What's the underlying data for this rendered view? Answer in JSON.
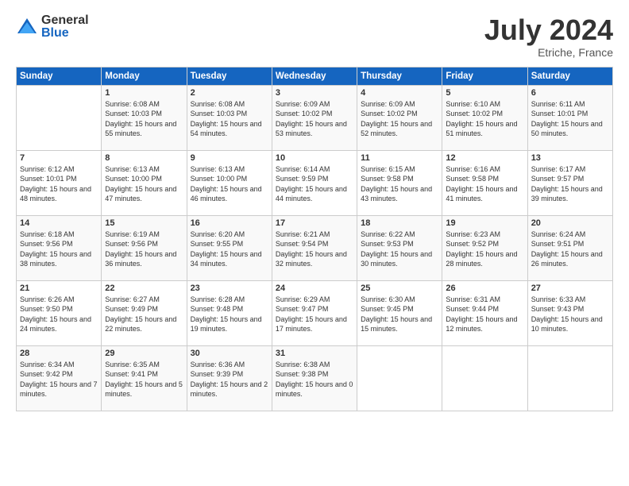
{
  "logo": {
    "general": "General",
    "blue": "Blue"
  },
  "title": "July 2024",
  "location": "Etriche, France",
  "days_of_week": [
    "Sunday",
    "Monday",
    "Tuesday",
    "Wednesday",
    "Thursday",
    "Friday",
    "Saturday"
  ],
  "weeks": [
    [
      {
        "day": "",
        "sunrise": "",
        "sunset": "",
        "daylight": ""
      },
      {
        "day": "1",
        "sunrise": "Sunrise: 6:08 AM",
        "sunset": "Sunset: 10:03 PM",
        "daylight": "Daylight: 15 hours and 55 minutes."
      },
      {
        "day": "2",
        "sunrise": "Sunrise: 6:08 AM",
        "sunset": "Sunset: 10:03 PM",
        "daylight": "Daylight: 15 hours and 54 minutes."
      },
      {
        "day": "3",
        "sunrise": "Sunrise: 6:09 AM",
        "sunset": "Sunset: 10:02 PM",
        "daylight": "Daylight: 15 hours and 53 minutes."
      },
      {
        "day": "4",
        "sunrise": "Sunrise: 6:09 AM",
        "sunset": "Sunset: 10:02 PM",
        "daylight": "Daylight: 15 hours and 52 minutes."
      },
      {
        "day": "5",
        "sunrise": "Sunrise: 6:10 AM",
        "sunset": "Sunset: 10:02 PM",
        "daylight": "Daylight: 15 hours and 51 minutes."
      },
      {
        "day": "6",
        "sunrise": "Sunrise: 6:11 AM",
        "sunset": "Sunset: 10:01 PM",
        "daylight": "Daylight: 15 hours and 50 minutes."
      }
    ],
    [
      {
        "day": "7",
        "sunrise": "Sunrise: 6:12 AM",
        "sunset": "Sunset: 10:01 PM",
        "daylight": "Daylight: 15 hours and 48 minutes."
      },
      {
        "day": "8",
        "sunrise": "Sunrise: 6:13 AM",
        "sunset": "Sunset: 10:00 PM",
        "daylight": "Daylight: 15 hours and 47 minutes."
      },
      {
        "day": "9",
        "sunrise": "Sunrise: 6:13 AM",
        "sunset": "Sunset: 10:00 PM",
        "daylight": "Daylight: 15 hours and 46 minutes."
      },
      {
        "day": "10",
        "sunrise": "Sunrise: 6:14 AM",
        "sunset": "Sunset: 9:59 PM",
        "daylight": "Daylight: 15 hours and 44 minutes."
      },
      {
        "day": "11",
        "sunrise": "Sunrise: 6:15 AM",
        "sunset": "Sunset: 9:58 PM",
        "daylight": "Daylight: 15 hours and 43 minutes."
      },
      {
        "day": "12",
        "sunrise": "Sunrise: 6:16 AM",
        "sunset": "Sunset: 9:58 PM",
        "daylight": "Daylight: 15 hours and 41 minutes."
      },
      {
        "day": "13",
        "sunrise": "Sunrise: 6:17 AM",
        "sunset": "Sunset: 9:57 PM",
        "daylight": "Daylight: 15 hours and 39 minutes."
      }
    ],
    [
      {
        "day": "14",
        "sunrise": "Sunrise: 6:18 AM",
        "sunset": "Sunset: 9:56 PM",
        "daylight": "Daylight: 15 hours and 38 minutes."
      },
      {
        "day": "15",
        "sunrise": "Sunrise: 6:19 AM",
        "sunset": "Sunset: 9:56 PM",
        "daylight": "Daylight: 15 hours and 36 minutes."
      },
      {
        "day": "16",
        "sunrise": "Sunrise: 6:20 AM",
        "sunset": "Sunset: 9:55 PM",
        "daylight": "Daylight: 15 hours and 34 minutes."
      },
      {
        "day": "17",
        "sunrise": "Sunrise: 6:21 AM",
        "sunset": "Sunset: 9:54 PM",
        "daylight": "Daylight: 15 hours and 32 minutes."
      },
      {
        "day": "18",
        "sunrise": "Sunrise: 6:22 AM",
        "sunset": "Sunset: 9:53 PM",
        "daylight": "Daylight: 15 hours and 30 minutes."
      },
      {
        "day": "19",
        "sunrise": "Sunrise: 6:23 AM",
        "sunset": "Sunset: 9:52 PM",
        "daylight": "Daylight: 15 hours and 28 minutes."
      },
      {
        "day": "20",
        "sunrise": "Sunrise: 6:24 AM",
        "sunset": "Sunset: 9:51 PM",
        "daylight": "Daylight: 15 hours and 26 minutes."
      }
    ],
    [
      {
        "day": "21",
        "sunrise": "Sunrise: 6:26 AM",
        "sunset": "Sunset: 9:50 PM",
        "daylight": "Daylight: 15 hours and 24 minutes."
      },
      {
        "day": "22",
        "sunrise": "Sunrise: 6:27 AM",
        "sunset": "Sunset: 9:49 PM",
        "daylight": "Daylight: 15 hours and 22 minutes."
      },
      {
        "day": "23",
        "sunrise": "Sunrise: 6:28 AM",
        "sunset": "Sunset: 9:48 PM",
        "daylight": "Daylight: 15 hours and 19 minutes."
      },
      {
        "day": "24",
        "sunrise": "Sunrise: 6:29 AM",
        "sunset": "Sunset: 9:47 PM",
        "daylight": "Daylight: 15 hours and 17 minutes."
      },
      {
        "day": "25",
        "sunrise": "Sunrise: 6:30 AM",
        "sunset": "Sunset: 9:45 PM",
        "daylight": "Daylight: 15 hours and 15 minutes."
      },
      {
        "day": "26",
        "sunrise": "Sunrise: 6:31 AM",
        "sunset": "Sunset: 9:44 PM",
        "daylight": "Daylight: 15 hours and 12 minutes."
      },
      {
        "day": "27",
        "sunrise": "Sunrise: 6:33 AM",
        "sunset": "Sunset: 9:43 PM",
        "daylight": "Daylight: 15 hours and 10 minutes."
      }
    ],
    [
      {
        "day": "28",
        "sunrise": "Sunrise: 6:34 AM",
        "sunset": "Sunset: 9:42 PM",
        "daylight": "Daylight: 15 hours and 7 minutes."
      },
      {
        "day": "29",
        "sunrise": "Sunrise: 6:35 AM",
        "sunset": "Sunset: 9:41 PM",
        "daylight": "Daylight: 15 hours and 5 minutes."
      },
      {
        "day": "30",
        "sunrise": "Sunrise: 6:36 AM",
        "sunset": "Sunset: 9:39 PM",
        "daylight": "Daylight: 15 hours and 2 minutes."
      },
      {
        "day": "31",
        "sunrise": "Sunrise: 6:38 AM",
        "sunset": "Sunset: 9:38 PM",
        "daylight": "Daylight: 15 hours and 0 minutes."
      },
      {
        "day": "",
        "sunrise": "",
        "sunset": "",
        "daylight": ""
      },
      {
        "day": "",
        "sunrise": "",
        "sunset": "",
        "daylight": ""
      },
      {
        "day": "",
        "sunrise": "",
        "sunset": "",
        "daylight": ""
      }
    ]
  ]
}
